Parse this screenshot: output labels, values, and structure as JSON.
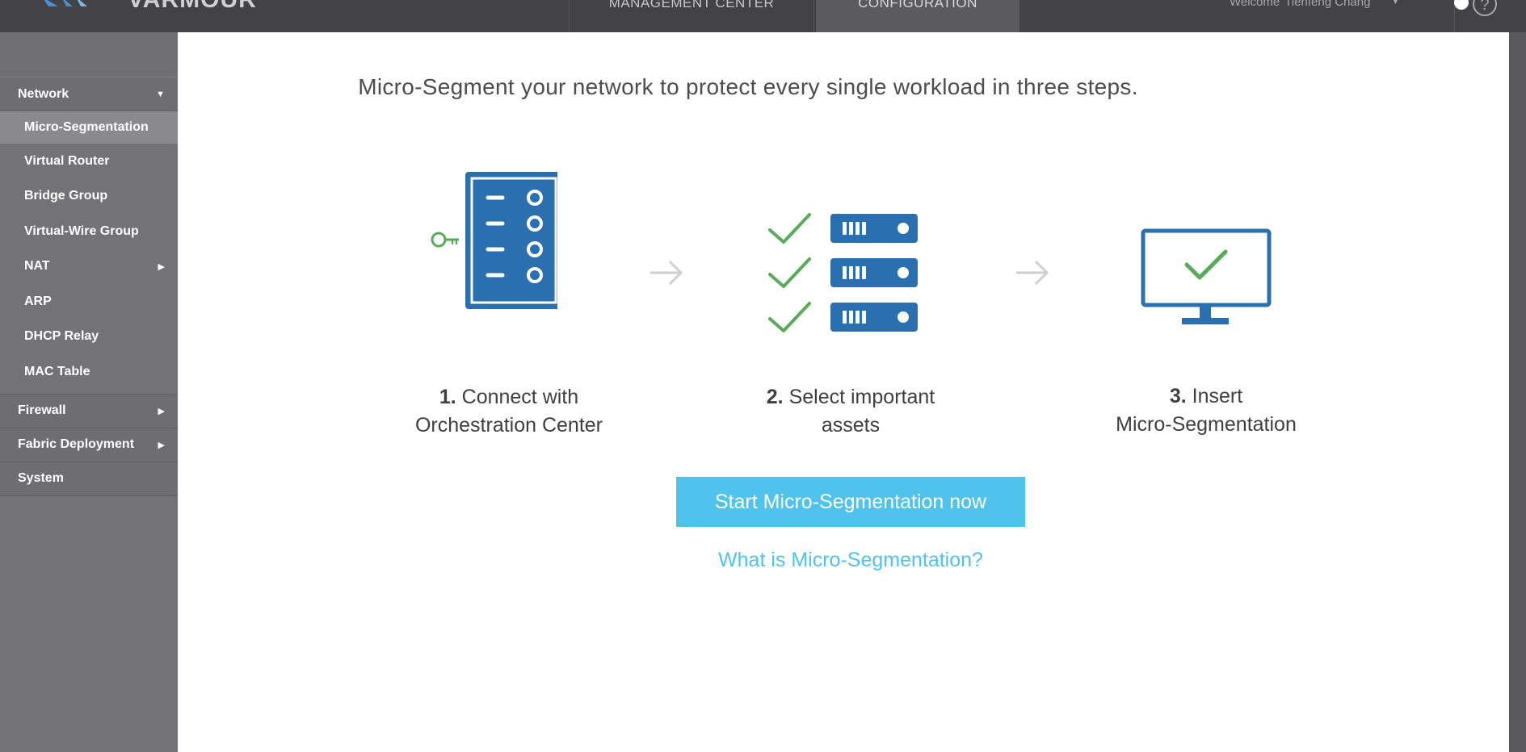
{
  "app": {
    "logo_text": "VARMOUR"
  },
  "topnav": {
    "tabs": [
      {
        "label": "MANAGEMENT CENTER"
      },
      {
        "label": "CONFIGURATION"
      }
    ],
    "welcome_label": "Welcome",
    "user_name": "Tienfeng Chang"
  },
  "sidebar": {
    "sections": [
      {
        "label": "Network",
        "items": [
          {
            "label": "Micro-Segmentation"
          },
          {
            "label": "Virtual Router"
          },
          {
            "label": "Bridge Group"
          },
          {
            "label": "Virtual-Wire Group"
          },
          {
            "label": "NAT"
          },
          {
            "label": "ARP"
          },
          {
            "label": "DHCP Relay"
          },
          {
            "label": "MAC Table"
          }
        ]
      },
      {
        "label": "Firewall"
      },
      {
        "label": "Fabric Deployment"
      },
      {
        "label": "System"
      }
    ]
  },
  "main": {
    "headline": "Micro-Segment your network to protect every single workload in three steps.",
    "steps": [
      {
        "number": "1.",
        "line1": "Connect with",
        "line2": "Orchestration Center"
      },
      {
        "number": "2.",
        "line1": "Select important",
        "line2": "assets"
      },
      {
        "number": "3.",
        "line1": "Insert",
        "line2": "Micro-Segmentation"
      }
    ],
    "cta_label": "Start Micro-Segmentation now",
    "link_label": "What is Micro-Segmentation?"
  },
  "colors": {
    "accent": "#4fc3ec",
    "icon_blue": "#2a6fb0",
    "check_green": "#5aaa5a",
    "topbar": "#434347",
    "sidebar": "#737377"
  }
}
